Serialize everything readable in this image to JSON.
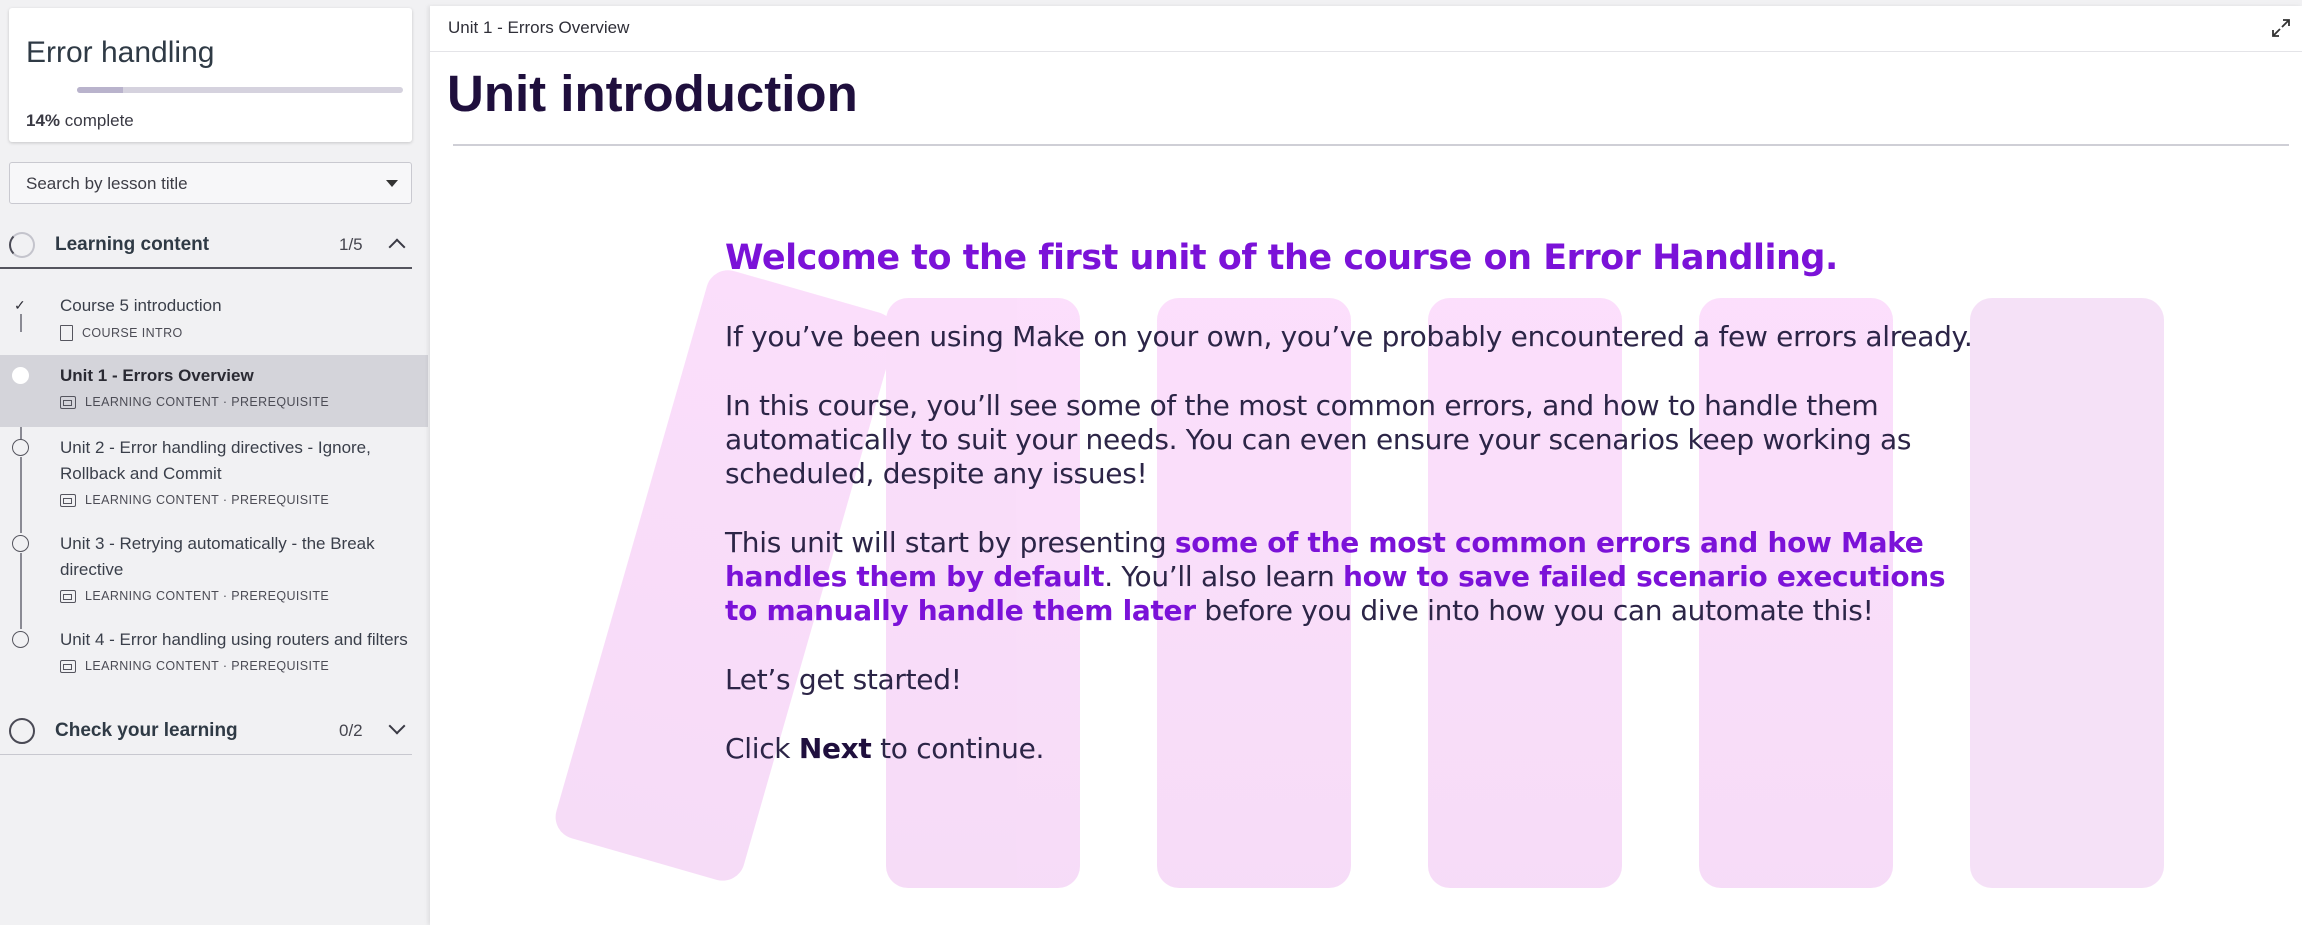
{
  "sidebar": {
    "course_title": "Error handling",
    "progress_percent": "14%",
    "progress_suffix": "complete",
    "progress_fraction": 0.14,
    "search_placeholder": "Search by lesson title",
    "sections": [
      {
        "title": "Learning content",
        "count": "1/5",
        "expanded": true,
        "lessons": [
          {
            "title": "Course 5 introduction",
            "meta": "COURSE INTRO",
            "status": "completed"
          },
          {
            "title": "Unit 1 - Errors Overview",
            "meta": "LEARNING CONTENT · PREREQUISITE",
            "status": "active"
          },
          {
            "title": "Unit 2 - Error handling directives - Ignore, Rollback and Commit",
            "meta": "LEARNING CONTENT · PREREQUISITE",
            "status": "not-started"
          },
          {
            "title": "Unit 3 - Retrying automatically - the Break directive",
            "meta": "LEARNING CONTENT · PREREQUISITE",
            "status": "not-started"
          },
          {
            "title": "Unit 4 - Error handling using routers and filters",
            "meta": "LEARNING CONTENT · PREREQUISITE",
            "status": "not-started"
          }
        ]
      },
      {
        "title": "Check your learning",
        "count": "0/2",
        "expanded": false
      }
    ]
  },
  "main": {
    "breadcrumb": "Unit 1 - Errors Overview",
    "page_title": "Unit introduction",
    "heading": "Welcome to the first unit of the course on Error Handling.",
    "para1": "If you’ve been using Make on your own, you’ve probably encountered a few errors already.",
    "para2": "In this course, you’ll see some of the most common errors, and how to handle them automatically to suit your needs. You can even ensure your scenarios keep working as scheduled, despite any issues!",
    "para3_a": "This unit will start by presenting ",
    "para3_b": "some of the most common errors and how Make handles them by default",
    "para3_c": ". You’ll also learn ",
    "para3_d": "how to save failed scenario executions to manually handle them later",
    "para3_e": " before you dive into how you can automate this!",
    "para4": "Let’s get started!",
    "para5_a": "Click ",
    "para5_b": "Next",
    "para5_c": " to continue."
  },
  "colors": {
    "accent_purple": "#7b12d8",
    "title_dark": "#1f0f3d",
    "active_lesson_bg": "#d4d4da",
    "decor_pink": "#f6d4f7"
  },
  "icons": [
    "caret-down-icon",
    "progress-ring-icon",
    "chevron-up-icon",
    "chevron-down-icon",
    "checkmark-icon",
    "lesson-type-icon",
    "document-icon",
    "expand-icon"
  ]
}
